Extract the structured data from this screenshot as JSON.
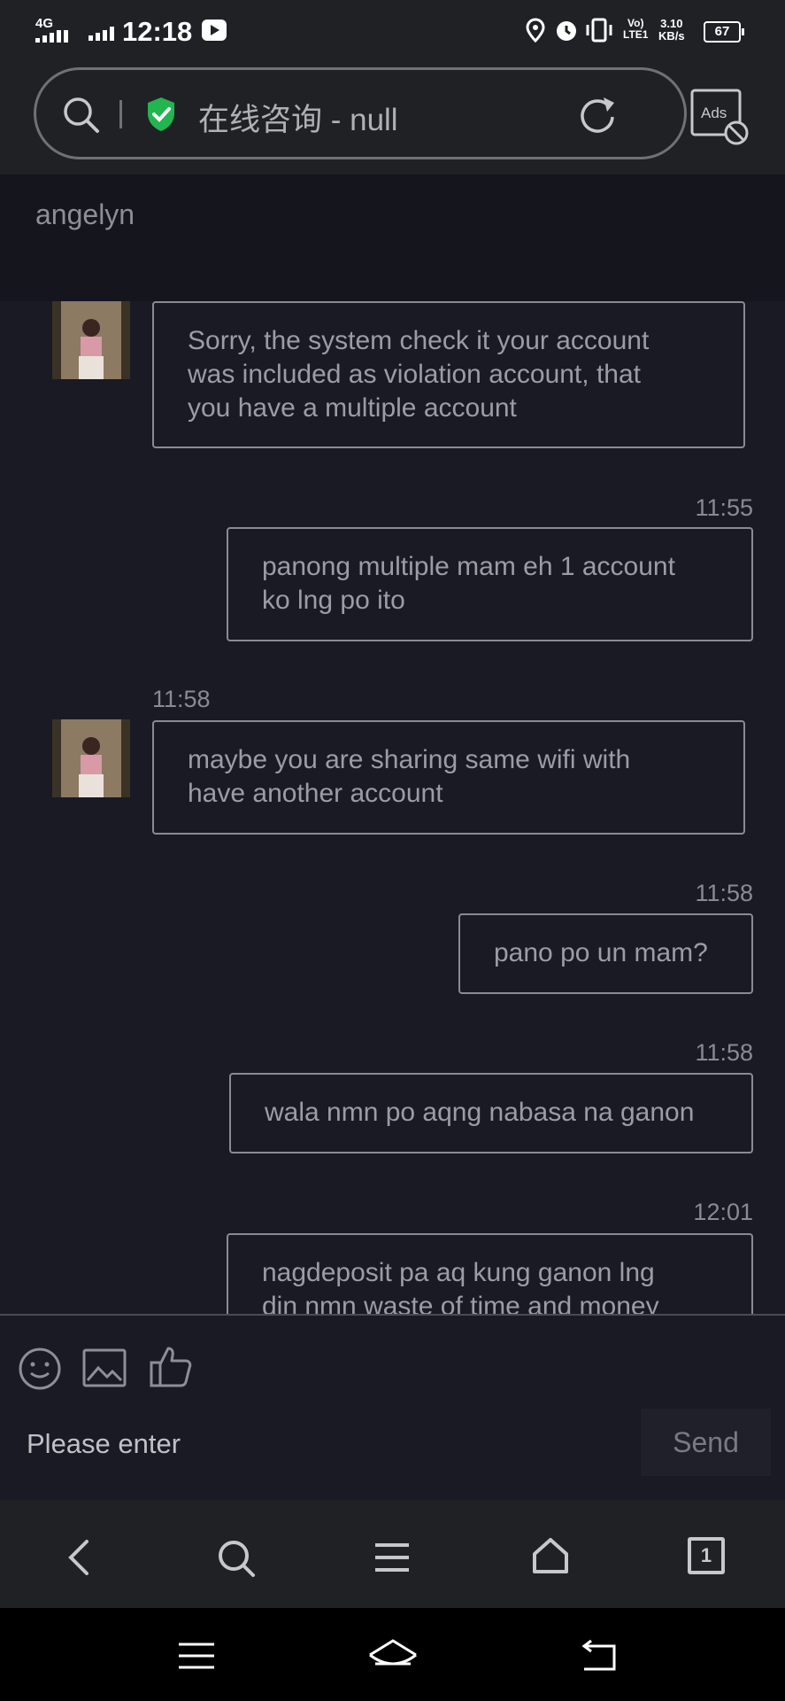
{
  "status_bar": {
    "network": "4G",
    "time": "12:18",
    "lte": [
      "Vo)",
      "LTE1"
    ],
    "speed": [
      "3.10",
      "KB/s"
    ],
    "battery": "67"
  },
  "browser": {
    "url_title": "在线咨询 - null",
    "ads_label": "Ads"
  },
  "chat": {
    "contact_name": "angelyn",
    "messages": [
      {
        "side": "incoming",
        "time": "",
        "lines": [
          "Sorry, the system check it your account",
          "was included as violation account, that",
          "you have a multiple account"
        ]
      },
      {
        "side": "outgoing",
        "time": "11:55",
        "lines": [
          "panong multiple mam eh 1 account",
          "ko lng po ito"
        ]
      },
      {
        "side": "incoming",
        "time": "11:58",
        "lines": [
          "maybe you are sharing same wifi with",
          "have another account"
        ]
      },
      {
        "side": "outgoing",
        "time": "11:58",
        "lines": [
          "pano po un mam?"
        ]
      },
      {
        "side": "outgoing",
        "time": "11:58",
        "lines": [
          "wala nmn po aqng nabasa na ganon"
        ]
      },
      {
        "side": "outgoing",
        "time": "12:01",
        "lines": [
          "nagdeposit pa aq kung ganon lng",
          "din nmn waste of time and money"
        ]
      }
    ]
  },
  "composer": {
    "placeholder": "Please enter",
    "send_label": "Send"
  },
  "browser_nav": {
    "tab_count": "1"
  }
}
